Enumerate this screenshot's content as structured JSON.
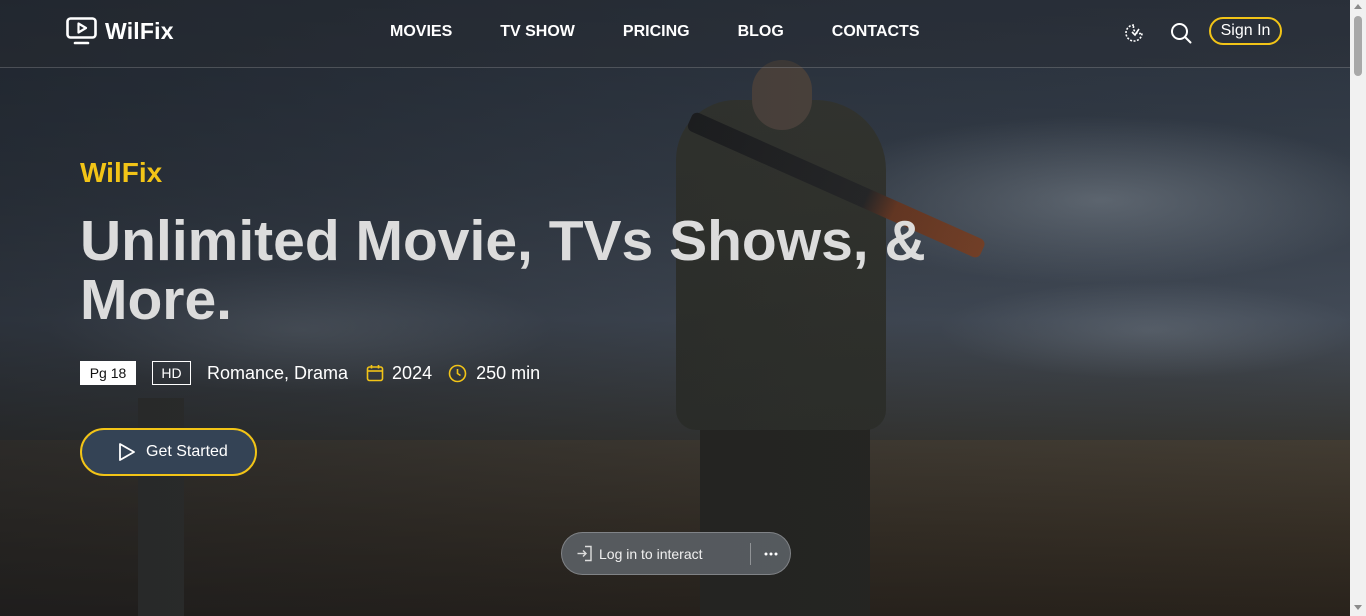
{
  "colors": {
    "accent": "#f2c417",
    "cta_bg": "#344355"
  },
  "header": {
    "brand": "WilFix",
    "logo_icon": "tv-play-icon",
    "nav": [
      "MOVIES",
      "TV SHOW",
      "PRICING",
      "BLOG",
      "CONTACTS"
    ],
    "theme_icon": "theme-toggle-icon",
    "search_icon": "search-icon",
    "sign_in_label": "Sign In"
  },
  "hero": {
    "tag": "WilFix",
    "headline": "Unlimited Movie, TVs Shows, & More.",
    "rating_badge": "Pg 18",
    "quality_badge": "HD",
    "genres": "Romance, Drama",
    "year": "2024",
    "duration": "250 min",
    "cta_label": "Get Started"
  },
  "login_pill": {
    "label": "Log in to interact",
    "more_icon": "more-dots-icon"
  }
}
